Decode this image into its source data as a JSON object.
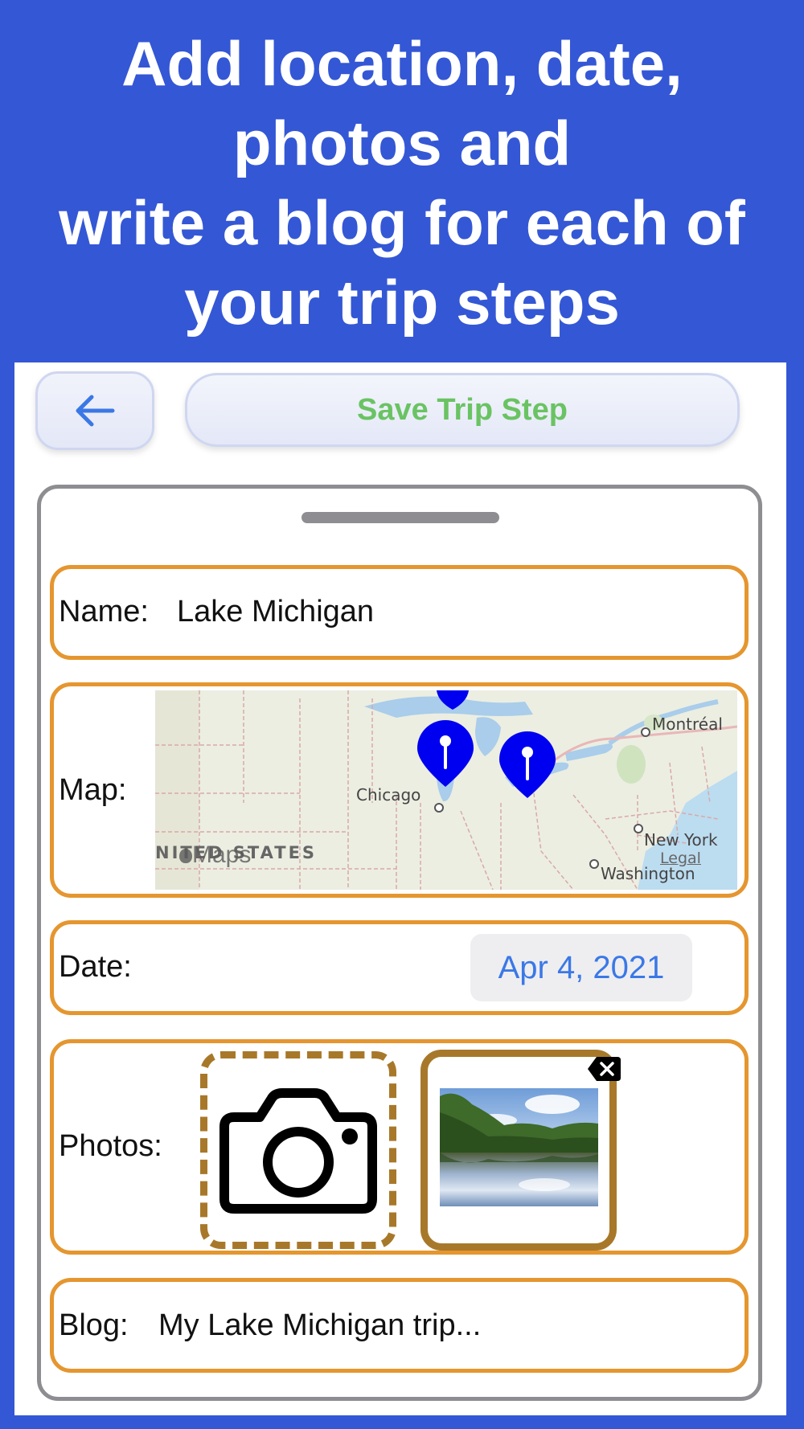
{
  "headline": {
    "line1": "Add location, date,",
    "line2": "photos and",
    "line3": "write a blog for each of",
    "line4": "your trip steps"
  },
  "toolbar": {
    "back_icon": "arrow-left-icon",
    "save_label": "Save Trip Step"
  },
  "form": {
    "name": {
      "label": "Name:",
      "value": "Lake Michigan"
    },
    "map": {
      "label": "Map:",
      "places": {
        "montreal": "Montréal",
        "chicago": "Chicago",
        "new_york": "New York",
        "washington": "Washington",
        "country": "NITED STATES"
      },
      "attribution": "Maps",
      "legal": "Legal",
      "pin_count": 3
    },
    "date": {
      "label": "Date:",
      "value": "Apr 4, 2021"
    },
    "photos": {
      "label": "Photos:",
      "add_icon": "camera-icon",
      "delete_icon": "delete-backspace-icon"
    },
    "blog": {
      "label": "Blog:",
      "value": "My Lake Michigan trip..."
    }
  },
  "colors": {
    "background": "#3457d5",
    "row_border": "#e5962f",
    "tile_border": "#a8782a",
    "save_text": "#6ac363",
    "date_text": "#3b78e6",
    "pin": "#0000f0"
  }
}
